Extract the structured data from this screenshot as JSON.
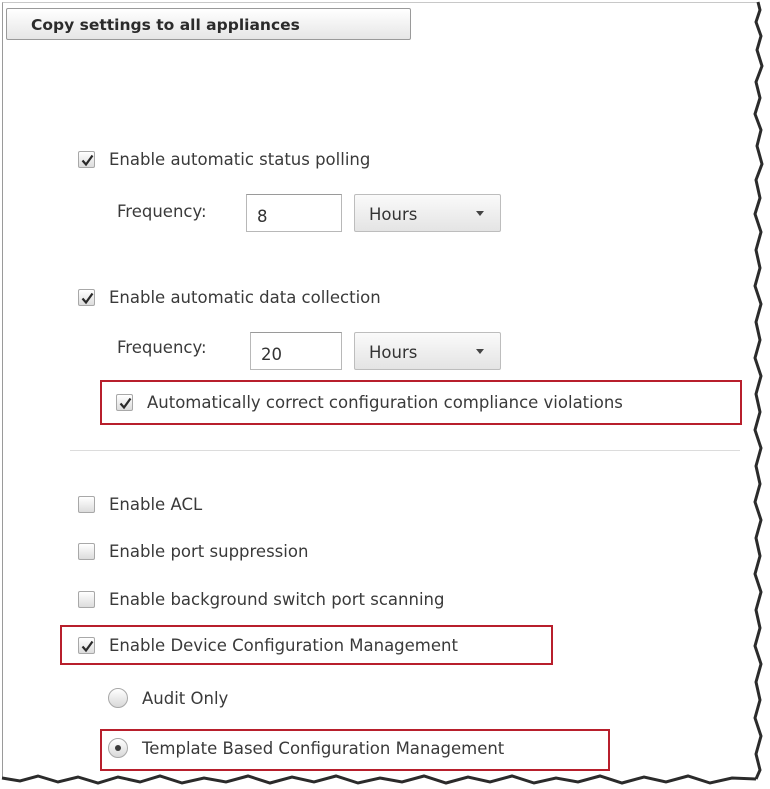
{
  "header": {
    "copy_button_label": "Copy settings to all appliances"
  },
  "status_polling": {
    "checkbox_label": "Enable automatic status polling",
    "checked": true,
    "frequency_label": "Frequency:",
    "frequency_value": "8",
    "unit": "Hours"
  },
  "data_collection": {
    "checkbox_label": "Enable automatic data collection",
    "checked": true,
    "frequency_label": "Frequency:",
    "frequency_value": "20",
    "unit": "Hours",
    "auto_correct_label": "Automatically correct configuration compliance violations",
    "auto_correct_checked": true
  },
  "options": {
    "acl_label": "Enable ACL",
    "port_suppression_label": "Enable port suppression",
    "background_scan_label": "Enable background switch port scanning",
    "dcm_label": "Enable Device Configuration Management",
    "dcm_checked": true
  },
  "dcm_modes": {
    "audit_only_label": "Audit Only",
    "template_label": "Template Based Configuration Management",
    "selected": "Template Based Configuration Management"
  },
  "colors": {
    "highlight": "#b81f2c",
    "text": "#3a3a3a"
  }
}
